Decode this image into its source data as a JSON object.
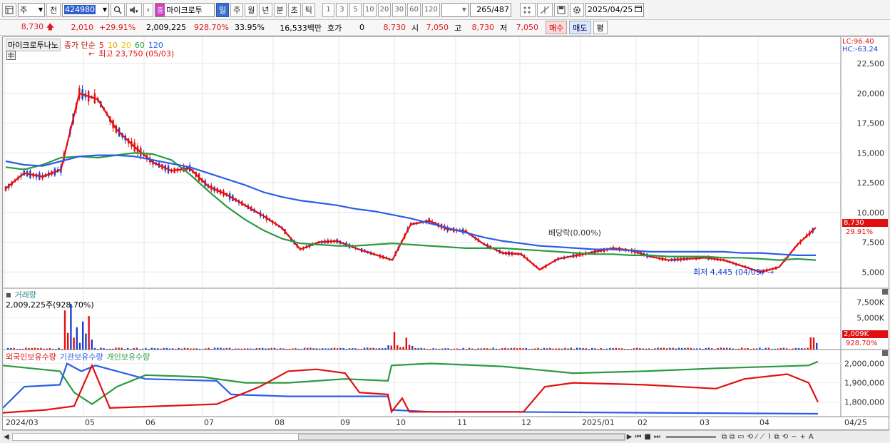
{
  "toolbar": {
    "type_select": "주",
    "prev_label": "전",
    "stock_code": "424980",
    "badge": "중",
    "stock_name": "마이크로투",
    "periods": [
      "일",
      "주",
      "월",
      "년",
      "분",
      "초",
      "틱"
    ],
    "active_period": "일",
    "intervals": [
      "1",
      "3",
      "5",
      "10",
      "20",
      "30",
      "60",
      "120"
    ],
    "count_display": "265",
    "count_total": "/487",
    "date": "2025/04/25"
  },
  "quote": {
    "price": "8,730",
    "change": "2,010",
    "change_pct": "+29.91%",
    "volume": "2,009,225",
    "volume_ratio": "928.70%",
    "turnover": "33.95%",
    "amount": "16,533백만",
    "hoga_label": "호가",
    "hoga_value": "0",
    "hoga_price": "8,730",
    "open_label": "시",
    "open": "7,050",
    "high_label": "고",
    "high": "8,730",
    "low_label": "저",
    "low": "7,050",
    "buy_label": "매수",
    "sell_label": "매도",
    "eval_label": "평"
  },
  "price_panel": {
    "stock_label": "마이크로투나노",
    "legend_title": "종가 단순",
    "ma_periods": [
      "5",
      "10",
      "20",
      "60",
      "120"
    ],
    "ma_colors": [
      "#e01010",
      "#f0a000",
      "#f5e000",
      "#2a9a40",
      "#2a5ee8"
    ],
    "high_annotation": "최고 23,750 (05/03)",
    "low_annotation": "최저 4,445 (04/09)",
    "dividend_annotation": "배당락(0.00%)",
    "lc": "LC:96.40",
    "hc": "HC:-63.24",
    "last_price_tag": "8,730",
    "last_pct_tag": "29.91%",
    "y_ticks": [
      "22,500",
      "20,000",
      "17,500",
      "15,000",
      "12,500",
      "10,000",
      "7,500",
      "5,000"
    ]
  },
  "volume_panel": {
    "title": "거래량",
    "value": "2,009,225주(928.70%)",
    "y_ticks": [
      "7,500K",
      "5,000K",
      "2,500K"
    ],
    "last_tag": "2,009K",
    "last_pct_tag": "928.70%"
  },
  "holdings_panel": {
    "legend": [
      "외국인보유수량",
      "기관보유수량",
      "개인보유수량"
    ],
    "legend_colors": [
      "#e01010",
      "#2a5ee8",
      "#2a9a40"
    ],
    "y_ticks": [
      "2,000,000",
      "1,900,000",
      "1,800,000"
    ]
  },
  "x_axis": {
    "labels": [
      "2024/03",
      "05",
      "06",
      "07",
      "08",
      "09",
      "10",
      "11",
      "12",
      "2025/01",
      "02",
      "03",
      "04",
      "04/25"
    ]
  },
  "chart_data": [
    {
      "type": "line",
      "title": "",
      "series": [
        {
          "name": "5",
          "color": "#e01010",
          "values": [
            12000,
            13300,
            13000,
            13600,
            20000,
            19500,
            17000,
            15500,
            14200,
            13500,
            13700,
            12200,
            11500,
            10600,
            9700,
            8700,
            6900,
            7500,
            7600,
            7000,
            6500,
            6000,
            9000,
            9300,
            8600,
            8400,
            7300,
            6600,
            6500,
            5200,
            6100,
            6400,
            6700,
            7000,
            6800,
            6300,
            6000,
            6100,
            6200,
            6000,
            5500,
            5000,
            5400,
            7300,
            8730
          ]
        },
        {
          "name": "60",
          "color": "#2a9a40",
          "values": [
            13800,
            13600,
            14000,
            14600,
            14700,
            14600,
            14800,
            15000,
            14900,
            14400,
            13200,
            11800,
            10500,
            9400,
            8500,
            7800,
            7400,
            7300,
            7200,
            7200,
            7300,
            7400,
            7300,
            7200,
            7100,
            7000,
            7000,
            7000,
            6900,
            6800,
            6700,
            6600,
            6500,
            6500,
            6400,
            6400,
            6300,
            6300,
            6300,
            6200,
            6200,
            6100,
            6000,
            6100,
            6000
          ]
        },
        {
          "name": "120",
          "color": "#2a5ee8",
          "values": [
            14300,
            14000,
            13900,
            14300,
            14700,
            14800,
            14800,
            14700,
            14400,
            14100,
            13800,
            13300,
            12800,
            12300,
            11700,
            11300,
            11000,
            10800,
            10600,
            10300,
            10100,
            9800,
            9500,
            9100,
            8700,
            8300,
            7900,
            7600,
            7400,
            7200,
            7100,
            7000,
            6900,
            6900,
            6800,
            6700,
            6700,
            6700,
            6700,
            6700,
            6600,
            6600,
            6500,
            6400,
            6400
          ]
        }
      ],
      "ylim": [
        4000,
        24000
      ]
    }
  ]
}
